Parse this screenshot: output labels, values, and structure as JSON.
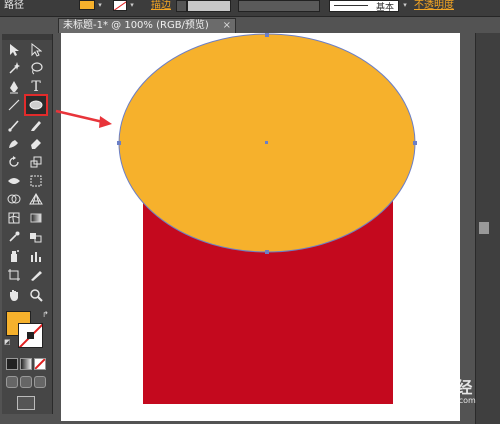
{
  "control_bar": {
    "object_type": "路径",
    "stroke_label": "描边",
    "brush_style": "基本",
    "opacity_label": "不透明度"
  },
  "document_tab": {
    "title": "未标题-1* @ 100% (RGB/预览)",
    "close": "×"
  },
  "toolbox": {
    "tools": [
      {
        "name": "selection-tool",
        "icon": "selection-arrow-icon"
      },
      {
        "name": "direct-selection-tool",
        "icon": "direct-selection-icon"
      },
      {
        "name": "magic-wand-tool",
        "icon": "magic-wand-icon"
      },
      {
        "name": "lasso-tool",
        "icon": "lasso-icon"
      },
      {
        "name": "pen-tool",
        "icon": "pen-icon"
      },
      {
        "name": "type-tool",
        "icon": "type-icon",
        "glyph": "T"
      },
      {
        "name": "line-tool",
        "icon": "line-segment-icon"
      },
      {
        "name": "ellipse-tool",
        "icon": "ellipse-icon",
        "selected": true
      },
      {
        "name": "paintbrush-tool",
        "icon": "paintbrush-icon"
      },
      {
        "name": "pencil-tool",
        "icon": "pencil-icon"
      },
      {
        "name": "blob-brush-tool",
        "icon": "blob-brush-icon"
      },
      {
        "name": "eraser-tool",
        "icon": "eraser-icon"
      },
      {
        "name": "rotate-tool",
        "icon": "rotate-icon"
      },
      {
        "name": "scale-tool",
        "icon": "scale-icon"
      },
      {
        "name": "width-tool",
        "icon": "width-icon"
      },
      {
        "name": "free-transform-tool",
        "icon": "free-transform-icon"
      },
      {
        "name": "shape-builder-tool",
        "icon": "shape-builder-icon"
      },
      {
        "name": "perspective-grid-tool",
        "icon": "perspective-grid-icon"
      },
      {
        "name": "mesh-tool",
        "icon": "mesh-icon"
      },
      {
        "name": "gradient-tool",
        "icon": "gradient-icon"
      },
      {
        "name": "eyedropper-tool",
        "icon": "eyedropper-icon"
      },
      {
        "name": "blend-tool",
        "icon": "blend-icon"
      },
      {
        "name": "symbol-sprayer-tool",
        "icon": "symbol-sprayer-icon"
      },
      {
        "name": "column-graph-tool",
        "icon": "column-graph-icon"
      },
      {
        "name": "artboard-tool",
        "icon": "artboard-icon"
      },
      {
        "name": "slice-tool",
        "icon": "slice-icon"
      },
      {
        "name": "hand-tool",
        "icon": "hand-icon"
      },
      {
        "name": "zoom-tool",
        "icon": "zoom-icon"
      }
    ],
    "fill_color": "#f6b12c",
    "stroke": "none"
  },
  "artwork": {
    "rectangle_color": "#c4091e",
    "ellipse_fill": "#f6b12c",
    "selection_color": "#6b7fc6"
  },
  "annotation": {
    "arrow_color": "#e8343a",
    "highlight_color": "#e12b2b"
  },
  "watermark": {
    "text": "Baidu经验",
    "sub": "jingyan.baidu.com"
  }
}
